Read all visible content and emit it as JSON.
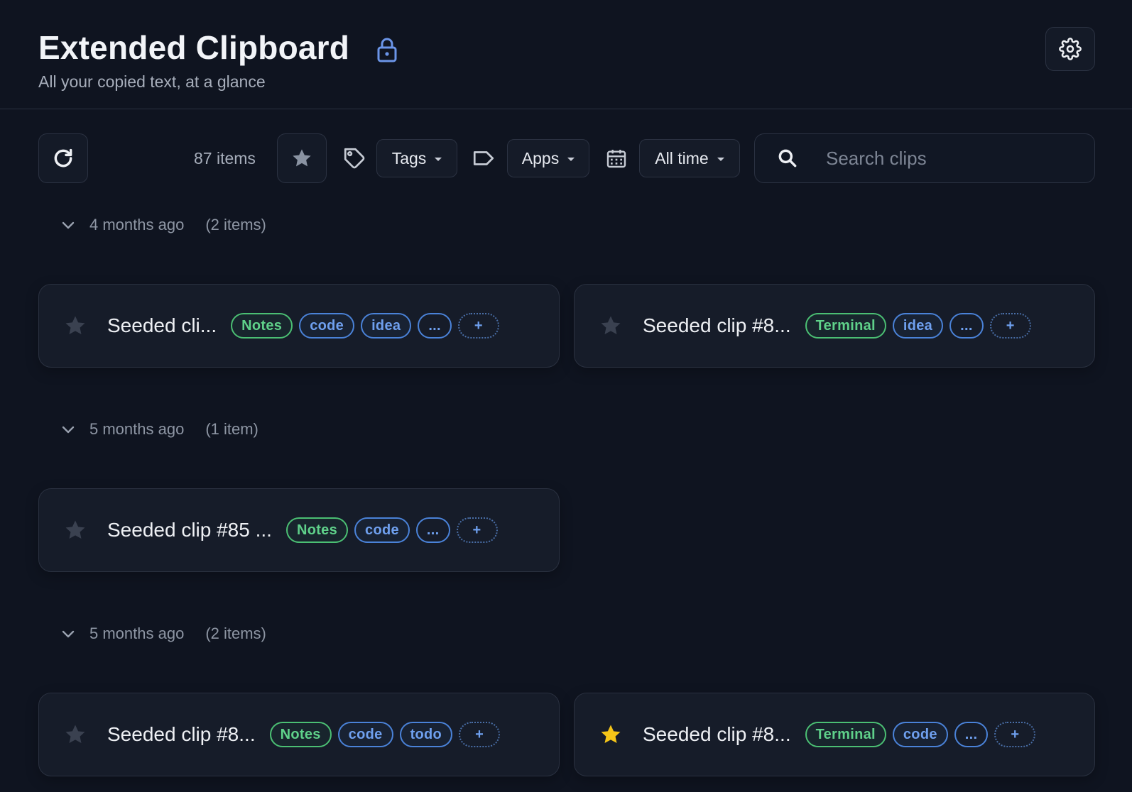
{
  "header": {
    "title": "Extended Clipboard",
    "subtitle": "All your copied text, at a glance",
    "lock_icon": "lock-icon",
    "settings_icon": "gear-icon"
  },
  "toolbar": {
    "refresh_icon": "refresh-icon",
    "item_count": "87 items",
    "favorites_icon": "star-icon",
    "tags_icon": "tag-icon",
    "tags_label": "Tags",
    "apps_icon": "label-icon",
    "apps_label": "Apps",
    "date_icon": "calendar-icon",
    "date_label": "All time",
    "search_placeholder": "Search clips",
    "search_value": ""
  },
  "colors": {
    "background": "#0f1420",
    "card": "#161c29",
    "app_tag": "#4bbf73",
    "label_tag": "#4a82d8",
    "star_active": "#f5c518",
    "star_inactive": "#3a4150",
    "accent": "#6b95e8"
  },
  "groups": [
    {
      "label": "4 months ago",
      "count": "(2 items)",
      "clips": [
        {
          "text": "Seeded cli...",
          "starred": false,
          "app": "Notes",
          "tags": [
            "code",
            "idea"
          ],
          "more": "...",
          "add": "+"
        },
        {
          "text": "Seeded clip #8...",
          "starred": false,
          "app": "Terminal",
          "tags": [
            "idea"
          ],
          "more": "...",
          "add": "+"
        }
      ]
    },
    {
      "label": "5 months ago",
      "count": "(1 item)",
      "clips": [
        {
          "text": "Seeded clip #85 ...",
          "starred": false,
          "app": "Notes",
          "tags": [
            "code"
          ],
          "more": "...",
          "add": "+"
        }
      ]
    },
    {
      "label": "5 months ago",
      "count": "(2 items)",
      "clips": [
        {
          "text": "Seeded clip #8...",
          "starred": false,
          "app": "Notes",
          "tags": [
            "code",
            "todo"
          ],
          "more": "",
          "add": "+"
        },
        {
          "text": "Seeded clip #8...",
          "starred": true,
          "app": "Terminal",
          "tags": [
            "code"
          ],
          "more": "...",
          "add": "+"
        }
      ]
    }
  ]
}
